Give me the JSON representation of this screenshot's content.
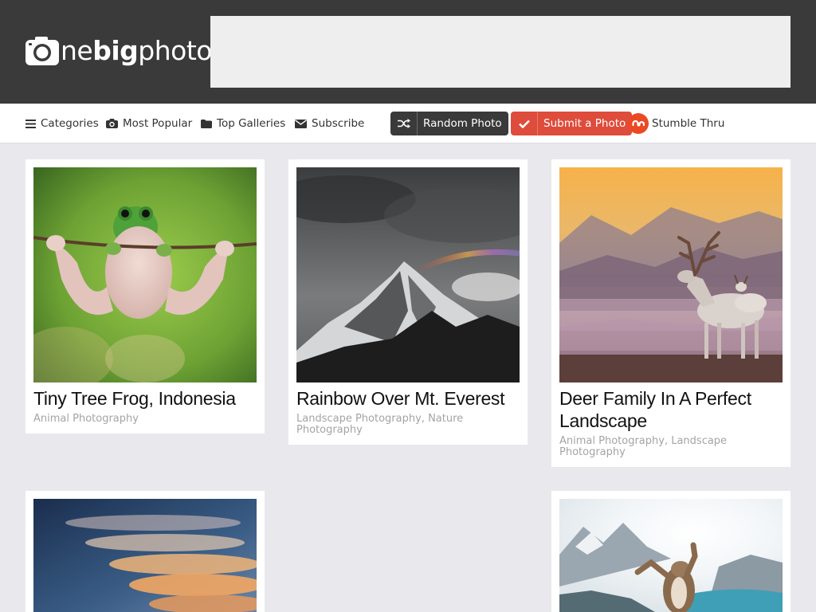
{
  "header": {
    "logo": {
      "prefix": "ne",
      "bold": "big",
      "suffix": "photo"
    }
  },
  "nav": {
    "categories": "Categories",
    "most_popular": "Most Popular",
    "top_galleries": "Top Galleries",
    "subscribe": "Subscribe",
    "random_photo": "Random Photo",
    "submit_photo": "Submit a Photo",
    "stumble": "Stumble Thru"
  },
  "colors": {
    "header_bg": "#3a3a3a",
    "submit_red": "#de4c3b",
    "stumble_orange": "#eb4924",
    "page_bg": "#e9e9ed"
  },
  "posts": [
    {
      "title": "Tiny Tree Frog, Indonesia",
      "tags": [
        "Animal Photography"
      ]
    },
    {
      "title": "Rainbow Over Mt. Everest",
      "tags": [
        "Landscape Photography",
        "Nature Photography"
      ]
    },
    {
      "title": "Deer Family In A Perfect Landscape",
      "tags": [
        "Animal Photography",
        "Landscape Photography"
      ]
    }
  ]
}
